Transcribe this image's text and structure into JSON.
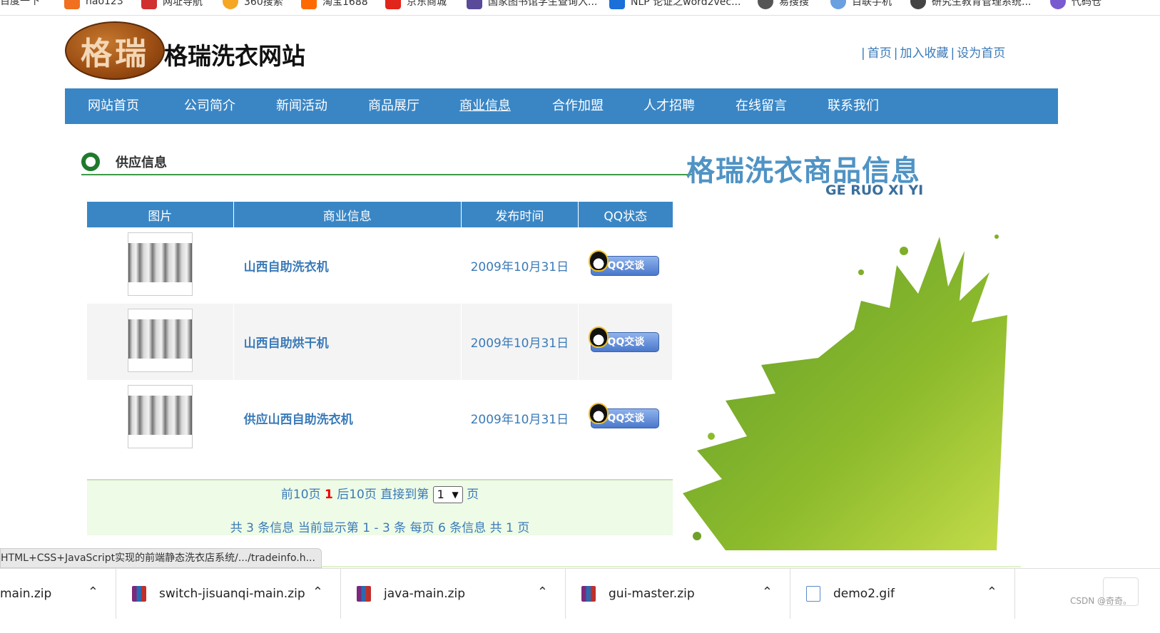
{
  "bookmarks": [
    {
      "label": "百度一下",
      "color": "#2b5fd9"
    },
    {
      "label": "hao123",
      "color": "#f07020"
    },
    {
      "label": "网址导航",
      "color": "#d03030"
    },
    {
      "label": "360搜索",
      "color": "#f5a623"
    },
    {
      "label": "淘宝1688",
      "color": "#ff6a00"
    },
    {
      "label": "京东商城",
      "color": "#e1251b"
    },
    {
      "label": "国家图书馆学生查询入...",
      "color": "#5a4a9a"
    },
    {
      "label": "NLP 论证之word2vec...",
      "color": "#1a6fd8"
    },
    {
      "label": "易搜搜",
      "color": "#555555"
    },
    {
      "label": "百联手机",
      "color": "#6aa0e0"
    },
    {
      "label": "研究生教育管理系统...",
      "color": "#444444"
    },
    {
      "label": "代码仓",
      "color": "#7a5ad0"
    }
  ],
  "site": {
    "logo_text": "格瑞",
    "title": "格瑞洗衣网站",
    "top_links": [
      "首页",
      "加入收藏",
      "设为首页"
    ]
  },
  "nav": [
    "网站首页",
    "公司简介",
    "新闻活动",
    "商品展厅",
    "商业信息",
    "合作加盟",
    "人才招聘",
    "在线留言",
    "联系我们"
  ],
  "section": {
    "title": "供应信息"
  },
  "table": {
    "headers": [
      "图片",
      "商业信息",
      "发布时间",
      "QQ状态"
    ],
    "rows": [
      {
        "name": "山西自助洗衣机",
        "date": "2009年10月31日",
        "qq_label": "QQ交谈"
      },
      {
        "name": "山西自助烘干机",
        "date": "2009年10月31日",
        "qq_label": "QQ交谈"
      },
      {
        "name": "供应山西自助洗衣机",
        "date": "2009年10月31日",
        "qq_label": "QQ交谈"
      }
    ]
  },
  "pager": {
    "prev": "前10页",
    "current": "1",
    "next": "后10页",
    "goto_label": "直接到第",
    "select_value": "1",
    "page_unit": "页",
    "summary": "共 3 条信息 当前显示第 1 - 3 条 每页 6 条信息 共 1 页"
  },
  "banner": {
    "title": "格瑞洗衣商品信息",
    "subtitle": "GE RUO XI YI"
  },
  "status_url": "HTML+CSS+JavaScript实现的前端静态洗衣店系统/.../tradeinfo.h...",
  "downloads": [
    "main.zip",
    "switch-jisuanqi-main.zip",
    "java-main.zip",
    "gui-master.zip",
    "demo2.gif"
  ],
  "watermark": "CSDN @奇奇。",
  "colors": {
    "nav_blue": "#3a86c5",
    "link_blue": "#3a7ab8",
    "section_green": "#3d9a47",
    "pager_bg": "#eefbe6",
    "splash_green": "#8dbb2c"
  }
}
